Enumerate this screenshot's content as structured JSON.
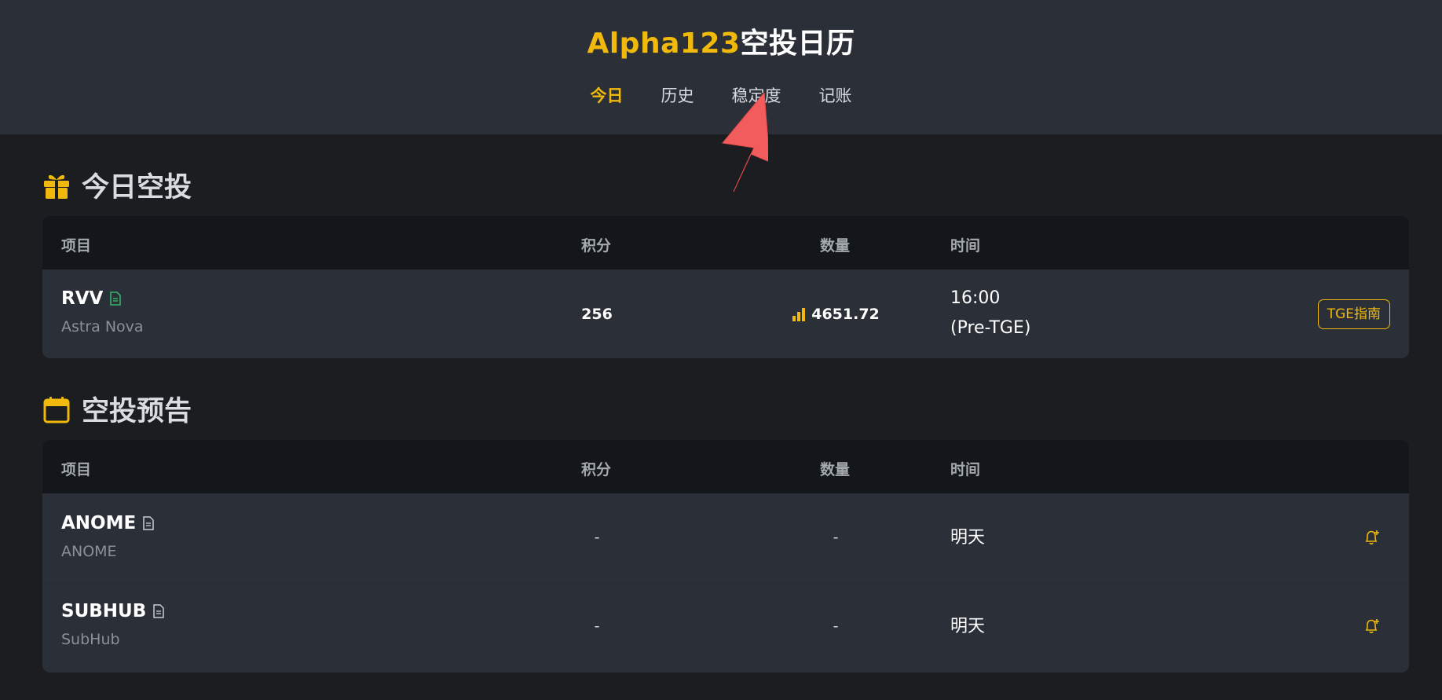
{
  "app": {
    "brand_accent": "Alpha123",
    "brand_rest": "空投日历",
    "accent_color": "#f0b90b"
  },
  "nav": {
    "items": [
      {
        "label": "今日",
        "active": true
      },
      {
        "label": "历史",
        "active": false
      },
      {
        "label": "稳定度",
        "active": false
      },
      {
        "label": "记账",
        "active": false
      }
    ]
  },
  "today": {
    "title": "今日空投",
    "icon": "gift-icon",
    "columns": {
      "project": "项目",
      "points": "积分",
      "quantity": "数量",
      "time": "时间"
    },
    "rows": [
      {
        "name": "RVV",
        "doc_icon": "document-icon",
        "subtitle": "Astra Nova",
        "points": "256",
        "quantity_icon": "bar-chart-icon",
        "quantity": "4651.72",
        "time": "16:00",
        "time_note": "(Pre-TGE)",
        "action": "TGE指南"
      }
    ]
  },
  "upcoming": {
    "title": "空投预告",
    "icon": "calendar-icon",
    "columns": {
      "project": "项目",
      "points": "积分",
      "quantity": "数量",
      "time": "时间"
    },
    "rows": [
      {
        "name": "ANOME",
        "subtitle": "ANOME",
        "points": "-",
        "quantity": "-",
        "time": "明天",
        "action_icon": "bell-plus-icon"
      },
      {
        "name": "SUBHUB",
        "subtitle": "SubHub",
        "points": "-",
        "quantity": "-",
        "time": "明天",
        "action_icon": "bell-plus-icon"
      }
    ]
  }
}
